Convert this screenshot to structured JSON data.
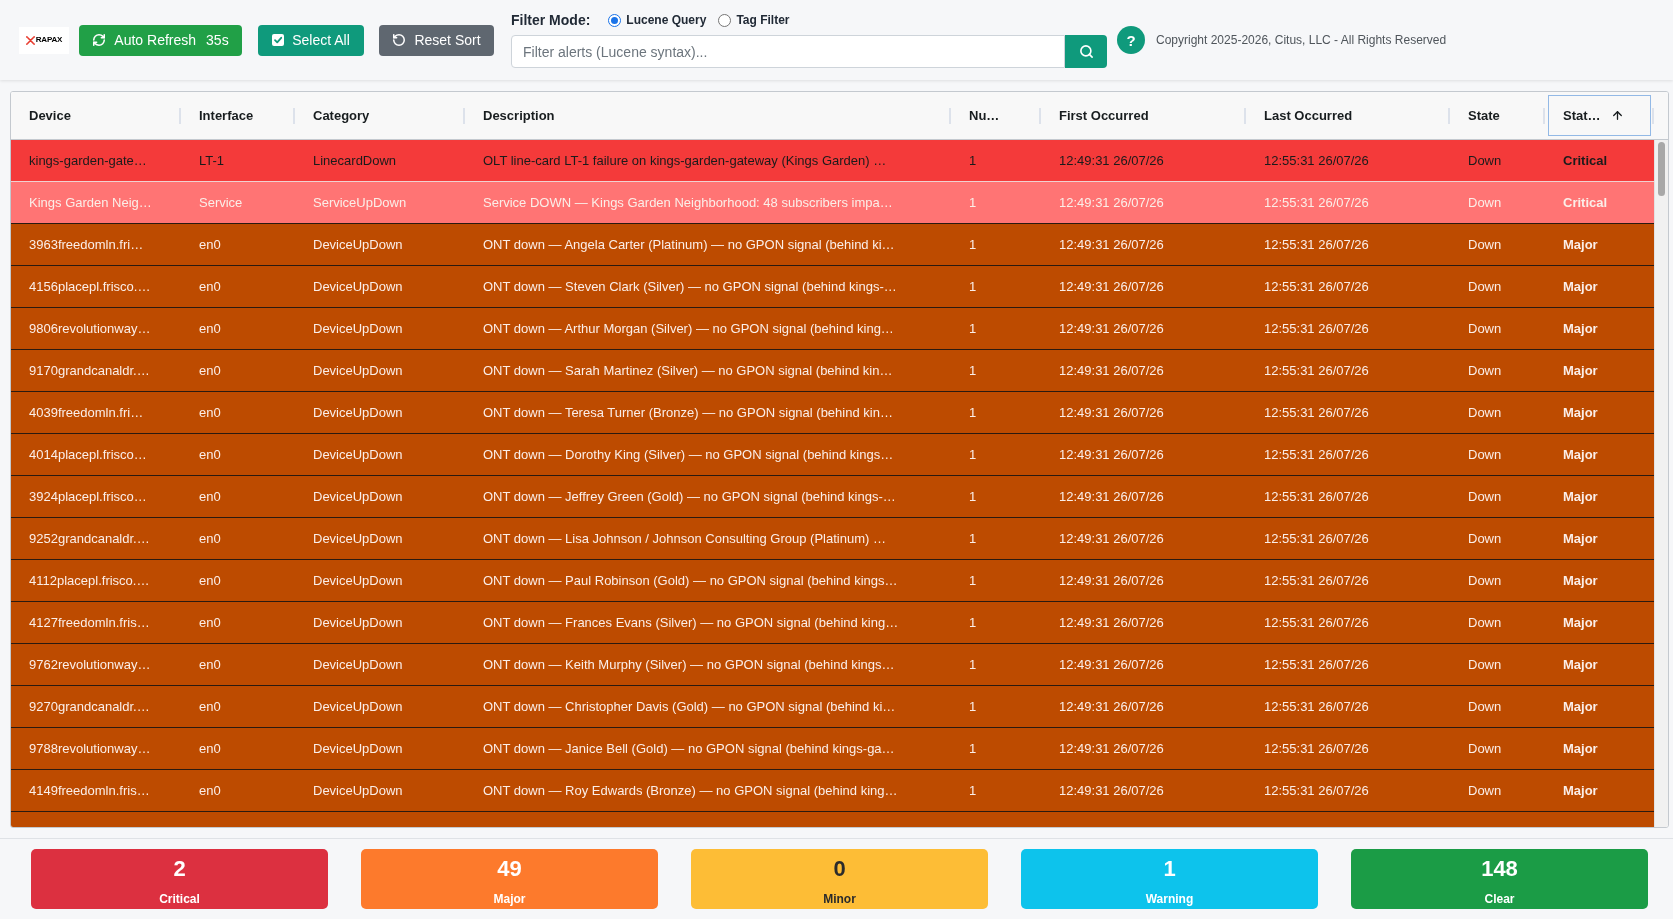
{
  "toolbar": {
    "logo": {
      "text": "RAPAX"
    },
    "auto_refresh": {
      "label": "Auto Refresh",
      "countdown": "35s"
    },
    "select_all": {
      "label": "Select All"
    },
    "reset_sort": {
      "label": "Reset Sort"
    },
    "filter": {
      "label": "Filter Mode:",
      "modes": [
        {
          "label": "Lucene Query",
          "selected": true
        },
        {
          "label": "Tag Filter",
          "selected": false
        }
      ],
      "placeholder": "Filter alerts (Lucene syntax)..."
    },
    "help": {
      "label": "?"
    },
    "copyright": "Copyright 2025-2026, Citus, LLC - All Rights Reserved"
  },
  "table": {
    "columns": [
      {
        "label": "Device",
        "sorted": false,
        "focused": false
      },
      {
        "label": "Interface",
        "sorted": false,
        "focused": false
      },
      {
        "label": "Category",
        "sorted": false,
        "focused": false
      },
      {
        "label": "Description",
        "sorted": false,
        "focused": false
      },
      {
        "label": "Nu…",
        "sorted": false,
        "focused": false
      },
      {
        "label": "First Occurred",
        "sorted": false,
        "focused": false
      },
      {
        "label": "Last Occurred",
        "sorted": false,
        "focused": false
      },
      {
        "label": "State",
        "sorted": false,
        "focused": false
      },
      {
        "label": "Stat…",
        "sorted": true,
        "focused": true
      }
    ],
    "rows": [
      {
        "device": "kings-garden-gate…",
        "interface": "LT-1",
        "category": "LinecardDown",
        "description": "OLT line-card LT-1 failure on kings-garden-gateway (Kings Garden) …",
        "count": "1",
        "first_occurred": "12:49:31 26/07/26",
        "last_occurred": "12:55:31 26/07/26",
        "state": "Down",
        "status": "Critical",
        "color": "#f43a3a",
        "selected": true
      },
      {
        "device": "Kings Garden Neig…",
        "interface": "Service",
        "category": "ServiceUpDown",
        "description": "Service DOWN — Kings Garden Neighborhood: 48 subscribers impa…",
        "count": "1",
        "first_occurred": "12:49:31 26/07/26",
        "last_occurred": "12:55:31 26/07/26",
        "state": "Down",
        "status": "Critical",
        "color": "#ff7474",
        "selected": false
      },
      {
        "device": "3963freedomln.fri…",
        "interface": "en0",
        "category": "DeviceUpDown",
        "description": "ONT down — Angela Carter (Platinum) — no GPON signal (behind ki…",
        "count": "1",
        "first_occurred": "12:49:31 26/07/26",
        "last_occurred": "12:55:31 26/07/26",
        "state": "Down",
        "status": "Major",
        "color": "#bd4b00",
        "selected": false
      },
      {
        "device": "4156placepl.frisco.…",
        "interface": "en0",
        "category": "DeviceUpDown",
        "description": "ONT down — Steven Clark (Silver) — no GPON signal (behind kings-…",
        "count": "1",
        "first_occurred": "12:49:31 26/07/26",
        "last_occurred": "12:55:31 26/07/26",
        "state": "Down",
        "status": "Major",
        "color": "#bd4b00",
        "selected": false
      },
      {
        "device": "9806revolutionway…",
        "interface": "en0",
        "category": "DeviceUpDown",
        "description": "ONT down — Arthur Morgan (Silver) — no GPON signal (behind king…",
        "count": "1",
        "first_occurred": "12:49:31 26/07/26",
        "last_occurred": "12:55:31 26/07/26",
        "state": "Down",
        "status": "Major",
        "color": "#bd4b00",
        "selected": false
      },
      {
        "device": "9170grandcanaldr.…",
        "interface": "en0",
        "category": "DeviceUpDown",
        "description": "ONT down — Sarah Martinez (Silver) — no GPON signal (behind kin…",
        "count": "1",
        "first_occurred": "12:49:31 26/07/26",
        "last_occurred": "12:55:31 26/07/26",
        "state": "Down",
        "status": "Major",
        "color": "#bd4b00",
        "selected": false
      },
      {
        "device": "4039freedomln.fri…",
        "interface": "en0",
        "category": "DeviceUpDown",
        "description": "ONT down — Teresa Turner (Bronze) — no GPON signal (behind kin…",
        "count": "1",
        "first_occurred": "12:49:31 26/07/26",
        "last_occurred": "12:55:31 26/07/26",
        "state": "Down",
        "status": "Major",
        "color": "#bd4b00",
        "selected": false
      },
      {
        "device": "4014placepl.frisco…",
        "interface": "en0",
        "category": "DeviceUpDown",
        "description": "ONT down — Dorothy King (Silver) — no GPON signal (behind kings…",
        "count": "1",
        "first_occurred": "12:49:31 26/07/26",
        "last_occurred": "12:55:31 26/07/26",
        "state": "Down",
        "status": "Major",
        "color": "#bd4b00",
        "selected": false
      },
      {
        "device": "3924placepl.frisco…",
        "interface": "en0",
        "category": "DeviceUpDown",
        "description": "ONT down — Jeffrey Green (Gold) — no GPON signal (behind kings-…",
        "count": "1",
        "first_occurred": "12:49:31 26/07/26",
        "last_occurred": "12:55:31 26/07/26",
        "state": "Down",
        "status": "Major",
        "color": "#bd4b00",
        "selected": false
      },
      {
        "device": "9252grandcanaldr.…",
        "interface": "en0",
        "category": "DeviceUpDown",
        "description": "ONT down — Lisa Johnson / Johnson Consulting Group (Platinum) …",
        "count": "1",
        "first_occurred": "12:49:31 26/07/26",
        "last_occurred": "12:55:31 26/07/26",
        "state": "Down",
        "status": "Major",
        "color": "#bd4b00",
        "selected": false
      },
      {
        "device": "4112placepl.frisco.…",
        "interface": "en0",
        "category": "DeviceUpDown",
        "description": "ONT down — Paul Robinson (Gold) — no GPON signal (behind kings…",
        "count": "1",
        "first_occurred": "12:49:31 26/07/26",
        "last_occurred": "12:55:31 26/07/26",
        "state": "Down",
        "status": "Major",
        "color": "#bd4b00",
        "selected": false
      },
      {
        "device": "4127freedomln.fris…",
        "interface": "en0",
        "category": "DeviceUpDown",
        "description": "ONT down — Frances Evans (Silver) — no GPON signal (behind king…",
        "count": "1",
        "first_occurred": "12:49:31 26/07/26",
        "last_occurred": "12:55:31 26/07/26",
        "state": "Down",
        "status": "Major",
        "color": "#bd4b00",
        "selected": false
      },
      {
        "device": "9762revolutionway…",
        "interface": "en0",
        "category": "DeviceUpDown",
        "description": "ONT down — Keith Murphy (Silver) — no GPON signal (behind kings…",
        "count": "1",
        "first_occurred": "12:49:31 26/07/26",
        "last_occurred": "12:55:31 26/07/26",
        "state": "Down",
        "status": "Major",
        "color": "#bd4b00",
        "selected": false
      },
      {
        "device": "9270grandcanaldr.…",
        "interface": "en0",
        "category": "DeviceUpDown",
        "description": "ONT down — Christopher Davis (Gold) — no GPON signal (behind ki…",
        "count": "1",
        "first_occurred": "12:49:31 26/07/26",
        "last_occurred": "12:55:31 26/07/26",
        "state": "Down",
        "status": "Major",
        "color": "#bd4b00",
        "selected": false
      },
      {
        "device": "9788revolutionway…",
        "interface": "en0",
        "category": "DeviceUpDown",
        "description": "ONT down — Janice Bell (Gold) — no GPON signal (behind kings-ga…",
        "count": "1",
        "first_occurred": "12:49:31 26/07/26",
        "last_occurred": "12:55:31 26/07/26",
        "state": "Down",
        "status": "Major",
        "color": "#bd4b00",
        "selected": false
      },
      {
        "device": "4149freedomln.fris…",
        "interface": "en0",
        "category": "DeviceUpDown",
        "description": "ONT down — Roy Edwards (Bronze) — no GPON signal (behind king…",
        "count": "1",
        "first_occurred": "12:49:31 26/07/26",
        "last_occurred": "12:55:31 26/07/26",
        "state": "Down",
        "status": "Major",
        "color": "#bd4b00",
        "selected": false
      }
    ]
  },
  "summary": [
    {
      "count": "2",
      "label": "Critical",
      "color": "#dc3040"
    },
    {
      "count": "49",
      "label": "Major",
      "color": "#fd7a2c"
    },
    {
      "count": "0",
      "label": "Minor",
      "color": "#fdbd36"
    },
    {
      "count": "1",
      "label": "Warning",
      "color": "#0dc3ec"
    },
    {
      "count": "148",
      "label": "Clear",
      "color": "#1b9c46"
    }
  ]
}
